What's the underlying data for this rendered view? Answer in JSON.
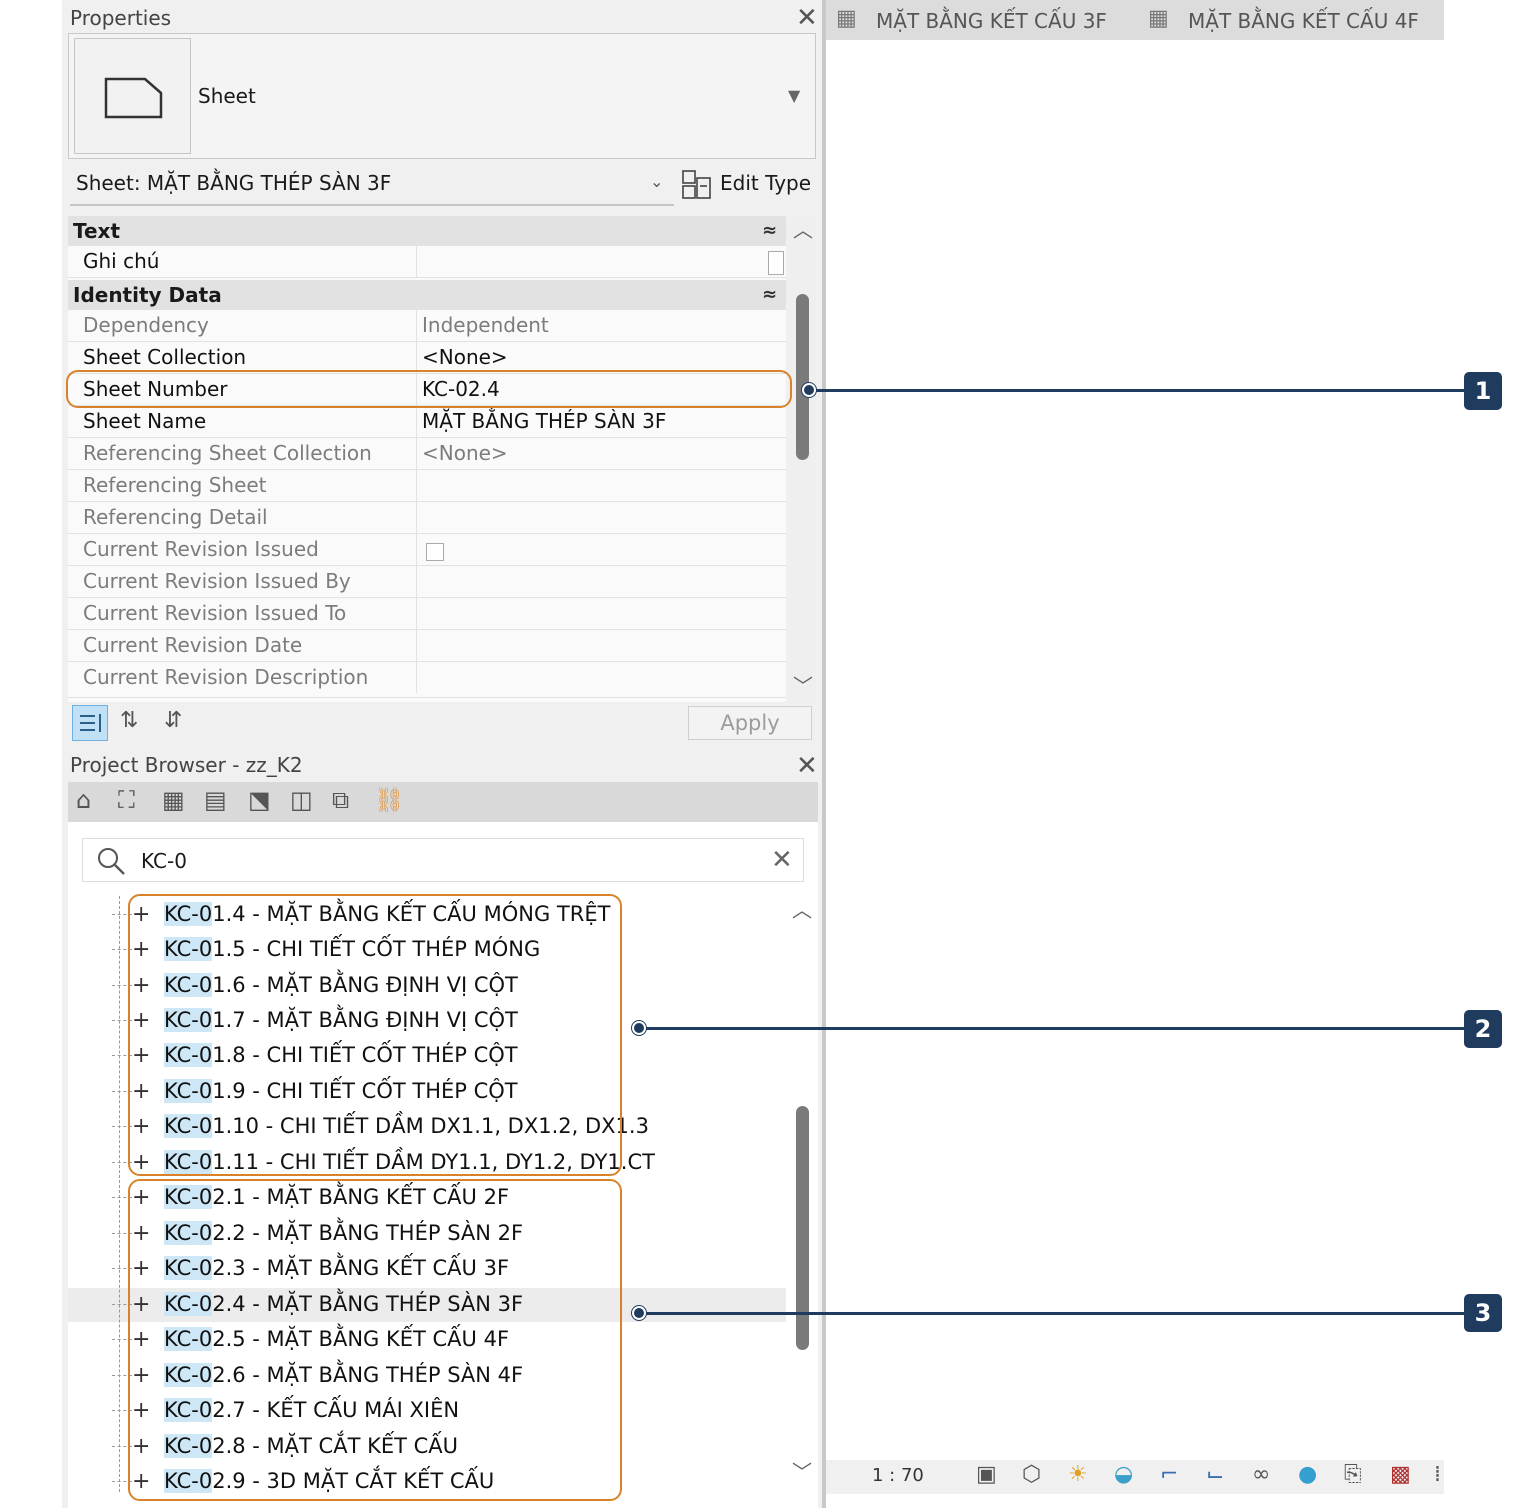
{
  "properties": {
    "title": "Properties",
    "type_name": "Sheet",
    "instance_selector": "Sheet: MẶT BẰNG THÉP SÀN 3F",
    "edit_type": "Edit Type",
    "categories": {
      "text": "Text",
      "identity": "Identity Data"
    },
    "rows": [
      {
        "key": "Ghi chú",
        "value": ""
      },
      {
        "key": "Dependency",
        "value": "Independent"
      },
      {
        "key": "Sheet Collection",
        "value": "<None>"
      },
      {
        "key": "Sheet Number",
        "value": "KC-02.4"
      },
      {
        "key": "Sheet Name",
        "value": "MẶT BẰNG THÉP SÀN 3F"
      },
      {
        "key": "Referencing Sheet Collection",
        "value": "<None>"
      },
      {
        "key": "Referencing Sheet",
        "value": ""
      },
      {
        "key": "Referencing Detail",
        "value": ""
      },
      {
        "key": "Current Revision Issued",
        "value": ""
      },
      {
        "key": "Current Revision Issued By",
        "value": ""
      },
      {
        "key": "Current Revision Issued To",
        "value": ""
      },
      {
        "key": "Current Revision Date",
        "value": ""
      },
      {
        "key": "Current Revision Description",
        "value": ""
      }
    ],
    "apply": "Apply"
  },
  "project_browser": {
    "title": "Project Browser - zz_K2",
    "search_value": "KC-0",
    "highlight": "KC-0",
    "items": [
      {
        "rest": "1.4 - MẶT BẰNG KẾT CẤU MÓNG TRỆT"
      },
      {
        "rest": "1.5 - CHI TIẾT CỐT THÉP MÓNG"
      },
      {
        "rest": "1.6 - MẶT BẰNG ĐỊNH VỊ CỘT"
      },
      {
        "rest": "1.7 - MẶT BẰNG ĐỊNH VỊ CỘT"
      },
      {
        "rest": "1.8 - CHI TIẾT CỐT THÉP CỘT"
      },
      {
        "rest": "1.9 - CHI TIẾT CỐT THÉP CỘT"
      },
      {
        "rest": "1.10 - CHI TIẾT DẦM DX1.1, DX1.2, DX1.3"
      },
      {
        "rest": "1.11 - CHI TIẾT DẦM DY1.1, DY1.2, DY1.CT"
      },
      {
        "rest": "2.1 - MẶT BẰNG KẾT CẤU 2F"
      },
      {
        "rest": "2.2 - MẶT BẰNG THÉP SÀN 2F"
      },
      {
        "rest": "2.3 - MẶT BẰNG KẾT CẤU 3F"
      },
      {
        "rest": "2.4 - MẶT BẰNG THÉP SÀN 3F"
      },
      {
        "rest": "2.5 - MẶT BẰNG KẾT CẤU 4F"
      },
      {
        "rest": "2.6 - MẶT BẰNG THÉP SÀN 4F"
      },
      {
        "rest": "2.7 - KẾT CẤU MÁI XIÊN"
      },
      {
        "rest": "2.8 - MẶT CẮT KẾT CẤU"
      },
      {
        "rest": "2.9 - 3D MẶT CẮT KẾT CẤU"
      }
    ]
  },
  "view_tabs": [
    "MẶT BẰNG KẾT CẤU 3F",
    "MẶT BẰNG KẾT CẤU 4F"
  ],
  "status": {
    "scale": "1 : 70"
  },
  "callouts": [
    "1",
    "2",
    "3"
  ],
  "colors": {
    "callout": "#1f3b5e",
    "outline": "#d9822b",
    "highlight": "#cde7f6"
  }
}
